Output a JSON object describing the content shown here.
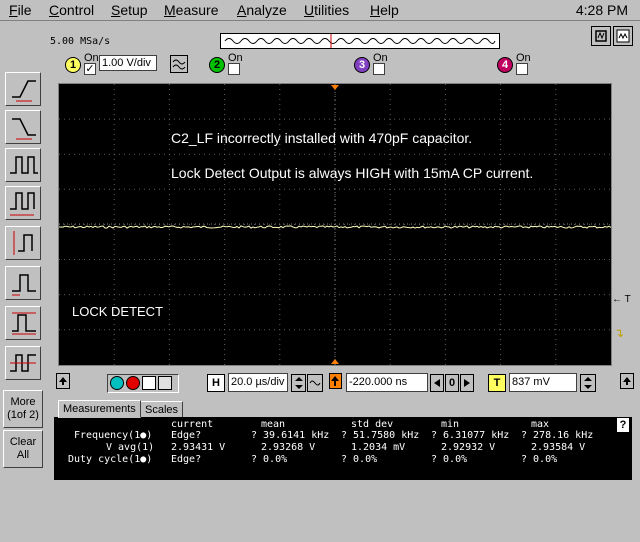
{
  "menubar": {
    "items": [
      "File",
      "Control",
      "Setup",
      "Measure",
      "Analyze",
      "Utilities",
      "Help"
    ],
    "clock": "4:28 PM"
  },
  "acquisition": {
    "sample_rate": "5.00 MSa/s"
  },
  "channels": {
    "ch1": {
      "number": "1",
      "on_label": "On",
      "checked": true,
      "scale": "1.00 V/div",
      "color": "#ffff60"
    },
    "ch2": {
      "number": "2",
      "on_label": "On",
      "checked": false,
      "color": "#00c000"
    },
    "ch3": {
      "number": "3",
      "on_label": "On",
      "checked": false,
      "color": "#8040c0"
    },
    "ch4": {
      "number": "4",
      "on_label": "On",
      "checked": false,
      "color": "#c00060"
    }
  },
  "side_buttons": {
    "more": "More (1of 2)",
    "clear": "Clear All"
  },
  "screen": {
    "annotation1": "C2_LF incorrectly installed with 470pF capacitor.",
    "annotation2": "Lock Detect Output is always HIGH with 15mA CP current.",
    "annotation3": "LOCK DETECT",
    "trigger_marker": "← T"
  },
  "timebase": {
    "horizontal_label": "H",
    "time_per_div": "20.0 µs/div",
    "delay": "-220.000 ns",
    "delay_step": "0",
    "trigger_label": "T",
    "trigger_level": "837 mV"
  },
  "measurements": {
    "tabs": [
      "Measurements",
      "Scales"
    ],
    "help": "?",
    "headers": [
      "current",
      "mean",
      "std dev",
      "min",
      "max"
    ],
    "rows": [
      {
        "name": "Frequency(1●)",
        "current": "Edge?",
        "mean": "? 39.6141 kHz",
        "std": "? 51.7580 kHz",
        "min": "? 6.31077 kHz",
        "max": "? 278.16 kHz"
      },
      {
        "name": "V avg(1)",
        "current": "2.93431 V",
        "mean": "2.93268 V",
        "std": "1.2034 mV",
        "min": "2.92932 V",
        "max": "2.93584 V"
      },
      {
        "name": "Duty cycle(1●)",
        "current": "Edge?",
        "mean": "? 0.0%",
        "std": "? 0.0%",
        "min": "? 0.0%",
        "max": "? 0.0%"
      }
    ]
  }
}
